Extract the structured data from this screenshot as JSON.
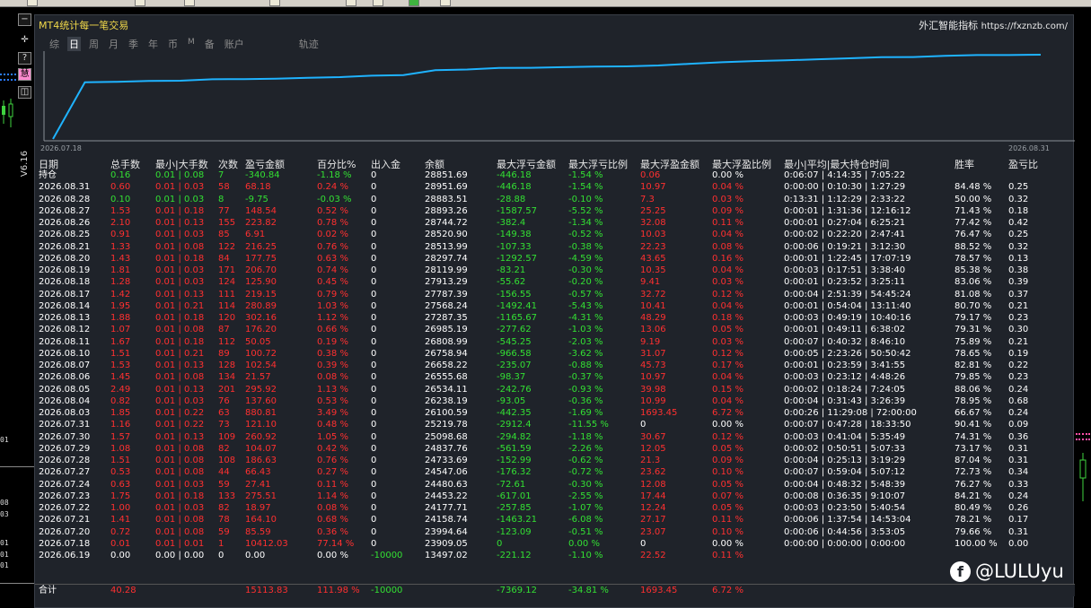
{
  "window": {
    "title": "MT4统计每一笔交易",
    "brand_name": "外汇智能指标",
    "brand_url": "https://fxznzb.com/"
  },
  "left_strip": {
    "buttons": [
      "−",
      "✛",
      "?",
      "慧",
      "◫"
    ],
    "version": "V6.16",
    "price_labels": [
      "01",
      "08",
      "03",
      "01",
      "01",
      "01"
    ]
  },
  "tabs": [
    {
      "label": "综",
      "active": false
    },
    {
      "label": "日",
      "active": true
    },
    {
      "label": "周",
      "active": false
    },
    {
      "label": "月",
      "active": false
    },
    {
      "label": "季",
      "active": false
    },
    {
      "label": "年",
      "active": false
    },
    {
      "label": "币",
      "active": false
    },
    {
      "label": "M",
      "active": false
    },
    {
      "label": "备",
      "active": false
    },
    {
      "label": "账户",
      "active": false
    },
    {
      "label": "轨迹",
      "active": false
    }
  ],
  "chart_data": {
    "type": "line",
    "x_start_label": "2026.07.18",
    "x_end_label": "2026.08.31",
    "color": "#1fb3ff"
  },
  "table": {
    "columns": [
      "日期",
      "总手数",
      "最小|大手数",
      "次数",
      "盈亏金额",
      "百分比%",
      "出入金",
      "余额",
      "最大浮亏金额",
      "最大浮亏比例",
      "最大浮盈金额",
      "最大浮盈比例",
      "最小|平均|最大持仓时间",
      "胜率",
      "盈亏比"
    ],
    "rows": [
      [
        "持仓",
        "0.16",
        "0.01 | 0.08",
        "7",
        "-340.84",
        "-1.18 %",
        "0",
        "28851.69",
        "-446.18",
        "-1.54 %",
        "0.06",
        "0.00 %",
        "0:06:07 | 4:14:35 | 7:05:22",
        "",
        ""
      ],
      [
        "2026.08.31",
        "0.60",
        "0.01 | 0.03",
        "58",
        "68.18",
        "0.24 %",
        "0",
        "28951.69",
        "-446.18",
        "-1.54 %",
        "10.97",
        "0.04 %",
        "0:00:00 | 0:10:30 | 1:27:29",
        "84.48 %",
        "0.25"
      ],
      [
        "2026.08.28",
        "0.10",
        "0.01 | 0.03",
        "8",
        "-9.75",
        "-0.03 %",
        "0",
        "28883.51",
        "-28.88",
        "-0.10 %",
        "7.3",
        "0.03 %",
        "0:13:31 | 1:12:29 | 2:33:22",
        "50.00 %",
        "0.32"
      ],
      [
        "2026.08.27",
        "1.53",
        "0.01 | 0.18",
        "77",
        "148.54",
        "0.52 %",
        "0",
        "28893.26",
        "-1587.57",
        "-5.52 %",
        "25.25",
        "0.09 %",
        "0:00:01 | 1:31:36 | 12:16:12",
        "71.43 %",
        "0.18"
      ],
      [
        "2026.08.26",
        "2.10",
        "0.01 | 0.13",
        "155",
        "223.82",
        "0.78 %",
        "0",
        "28744.72",
        "-382.4",
        "-1.34 %",
        "32.08",
        "0.11 %",
        "0:00:01 | 0:27:04 | 6:25:21",
        "77.42 %",
        "0.42"
      ],
      [
        "2026.08.25",
        "0.91",
        "0.01 | 0.03",
        "85",
        "6.91",
        "0.02 %",
        "0",
        "28520.90",
        "-149.38",
        "-0.52 %",
        "10.03",
        "0.04 %",
        "0:00:02 | 0:22:20 | 2:47:41",
        "76.47 %",
        "0.25"
      ],
      [
        "2026.08.21",
        "1.33",
        "0.01 | 0.08",
        "122",
        "216.25",
        "0.76 %",
        "0",
        "28513.99",
        "-107.33",
        "-0.38 %",
        "22.23",
        "0.08 %",
        "0:00:06 | 0:19:21 | 3:12:30",
        "88.52 %",
        "0.32"
      ],
      [
        "2026.08.20",
        "1.43",
        "0.01 | 0.18",
        "84",
        "177.75",
        "0.63 %",
        "0",
        "28297.74",
        "-1292.57",
        "-4.59 %",
        "43.65",
        "0.16 %",
        "0:00:01 | 1:22:45 | 17:07:19",
        "78.57 %",
        "0.13"
      ],
      [
        "2026.08.19",
        "1.81",
        "0.01 | 0.03",
        "171",
        "206.70",
        "0.74 %",
        "0",
        "28119.99",
        "-83.21",
        "-0.30 %",
        "10.35",
        "0.04 %",
        "0:00:03 | 0:17:51 | 3:38:40",
        "85.38 %",
        "0.38"
      ],
      [
        "2026.08.18",
        "1.28",
        "0.01 | 0.03",
        "124",
        "125.90",
        "0.45 %",
        "0",
        "27913.29",
        "-55.62",
        "-0.20 %",
        "9.41",
        "0.03 %",
        "0:00:01 | 0:23:52 | 3:25:11",
        "83.06 %",
        "0.39"
      ],
      [
        "2026.08.17",
        "1.42",
        "0.01 | 0.13",
        "111",
        "219.15",
        "0.79 %",
        "0",
        "27787.39",
        "-156.55",
        "-0.57 %",
        "32.72",
        "0.12 %",
        "0:00:04 | 2:51:39 | 54:45:24",
        "81.08 %",
        "0.37"
      ],
      [
        "2026.08.14",
        "1.95",
        "0.01 | 0.21",
        "114",
        "280.89",
        "1.03 %",
        "0",
        "27568.24",
        "-1492.41",
        "-5.43 %",
        "10.41",
        "0.04 %",
        "0:00:01 | 0:54:04 | 13:11:40",
        "80.70 %",
        "0.21"
      ],
      [
        "2026.08.13",
        "1.88",
        "0.01 | 0.18",
        "120",
        "302.16",
        "1.12 %",
        "0",
        "27287.35",
        "-1165.67",
        "-4.31 %",
        "48.29",
        "0.18 %",
        "0:00:03 | 0:49:19 | 10:40:16",
        "79.17 %",
        "0.23"
      ],
      [
        "2026.08.12",
        "1.07",
        "0.01 | 0.08",
        "87",
        "176.20",
        "0.66 %",
        "0",
        "26985.19",
        "-277.62",
        "-1.03 %",
        "13.06",
        "0.05 %",
        "0:00:01 | 0:49:11 | 6:38:02",
        "79.31 %",
        "0.30"
      ],
      [
        "2026.08.11",
        "1.67",
        "0.01 | 0.18",
        "112",
        "50.05",
        "0.19 %",
        "0",
        "26808.99",
        "-545.25",
        "-2.03 %",
        "9.19",
        "0.03 %",
        "0:00:07 | 0:40:32 | 8:46:10",
        "75.89 %",
        "0.21"
      ],
      [
        "2026.08.10",
        "1.51",
        "0.01 | 0.21",
        "89",
        "100.72",
        "0.38 %",
        "0",
        "26758.94",
        "-966.58",
        "-3.62 %",
        "31.07",
        "0.12 %",
        "0:00:05 | 2:23:26 | 50:50:42",
        "78.65 %",
        "0.19"
      ],
      [
        "2026.08.07",
        "1.53",
        "0.01 | 0.13",
        "128",
        "102.54",
        "0.39 %",
        "0",
        "26658.22",
        "-235.07",
        "-0.88 %",
        "45.73",
        "0.17 %",
        "0:00:01 | 0:23:59 | 3:41:55",
        "82.81 %",
        "0.22"
      ],
      [
        "2026.08.06",
        "1.45",
        "0.01 | 0.08",
        "134",
        "21.57",
        "0.08 %",
        "0",
        "26555.68",
        "-98.37",
        "-0.37 %",
        "10.97",
        "0.04 %",
        "0:00:03 | 0:23:12 | 4:48:26",
        "79.85 %",
        "0.23"
      ],
      [
        "2026.08.05",
        "2.49",
        "0.01 | 0.13",
        "201",
        "295.92",
        "1.13 %",
        "0",
        "26534.11",
        "-242.76",
        "-0.93 %",
        "39.98",
        "0.15 %",
        "0:00:02 | 0:18:24 | 7:24:05",
        "88.06 %",
        "0.24"
      ],
      [
        "2026.08.04",
        "0.82",
        "0.01 | 0.03",
        "76",
        "137.60",
        "0.53 %",
        "0",
        "26238.19",
        "-93.05",
        "-0.36 %",
        "10.99",
        "0.04 %",
        "0:00:04 | 0:31:43 | 3:26:39",
        "78.95 %",
        "0.68"
      ],
      [
        "2026.08.03",
        "1.85",
        "0.01 | 0.22",
        "63",
        "880.81",
        "3.49 %",
        "0",
        "26100.59",
        "-442.35",
        "-1.69 %",
        "1693.45",
        "6.72 %",
        "0:00:26 | 11:29:08 | 72:00:00",
        "66.67 %",
        "0.24"
      ],
      [
        "2026.07.31",
        "1.16",
        "0.01 | 0.22",
        "73",
        "121.10",
        "0.48 %",
        "0",
        "25219.78",
        "-2912.4",
        "-11.55 %",
        "0",
        "0.00 %",
        "0:00:07 | 0:47:28 | 18:33:50",
        "90.41 %",
        "0.09"
      ],
      [
        "2026.07.30",
        "1.57",
        "0.01 | 0.13",
        "109",
        "260.92",
        "1.05 %",
        "0",
        "25098.68",
        "-294.82",
        "-1.18 %",
        "30.67",
        "0.12 %",
        "0:00:03 | 0:41:04 | 5:35:49",
        "74.31 %",
        "0.36"
      ],
      [
        "2026.07.29",
        "1.08",
        "0.01 | 0.08",
        "82",
        "104.07",
        "0.42 %",
        "0",
        "24837.76",
        "-561.59",
        "-2.26 %",
        "12.05",
        "0.05 %",
        "0:00:02 | 0:50:51 | 5:07:33",
        "73.17 %",
        "0.31"
      ],
      [
        "2026.07.28",
        "1.51",
        "0.01 | 0.08",
        "108",
        "186.63",
        "0.76 %",
        "0",
        "24733.69",
        "-152.99",
        "-0.62 %",
        "21.3",
        "0.09 %",
        "0:00:04 | 0:25:13 | 3:19:29",
        "87.04 %",
        "0.31"
      ],
      [
        "2026.07.27",
        "0.53",
        "0.01 | 0.08",
        "44",
        "66.43",
        "0.27 %",
        "0",
        "24547.06",
        "-176.32",
        "-0.72 %",
        "23.62",
        "0.10 %",
        "0:00:07 | 0:59:04 | 5:07:12",
        "72.73 %",
        "0.34"
      ],
      [
        "2026.07.24",
        "0.63",
        "0.01 | 0.03",
        "59",
        "27.41",
        "0.11 %",
        "0",
        "24480.63",
        "-72.61",
        "-0.30 %",
        "12.08",
        "0.05 %",
        "0:00:04 | 0:48:32 | 5:48:39",
        "76.27 %",
        "0.33"
      ],
      [
        "2026.07.23",
        "1.75",
        "0.01 | 0.18",
        "133",
        "275.51",
        "1.14 %",
        "0",
        "24453.22",
        "-617.01",
        "-2.55 %",
        "17.44",
        "0.07 %",
        "0:00:08 | 0:36:35 | 9:10:07",
        "84.21 %",
        "0.24"
      ],
      [
        "2026.07.22",
        "1.00",
        "0.01 | 0.03",
        "82",
        "18.97",
        "0.08 %",
        "0",
        "24177.71",
        "-257.85",
        "-1.07 %",
        "12.24",
        "0.05 %",
        "0:00:03 | 0:23:50 | 5:40:54",
        "80.49 %",
        "0.26"
      ],
      [
        "2026.07.21",
        "1.41",
        "0.01 | 0.08",
        "78",
        "164.10",
        "0.68 %",
        "0",
        "24158.74",
        "-1463.21",
        "-6.08 %",
        "27.17",
        "0.11 %",
        "0:00:06 | 1:37:54 | 14:53:04",
        "78.21 %",
        "0.17"
      ],
      [
        "2026.07.20",
        "0.72",
        "0.01 | 0.08",
        "59",
        "85.59",
        "0.36 %",
        "0",
        "23994.64",
        "-123.09",
        "-0.51 %",
        "23.07",
        "0.10 %",
        "0:00:06 | 0:44:56 | 3:53:05",
        "79.66 %",
        "0.31"
      ],
      [
        "2026.07.18",
        "0.01",
        "0.01 | 0.01",
        "1",
        "10412.03",
        "77.14 %",
        "0",
        "23909.05",
        "0",
        "0.00 %",
        "0",
        "0.00 %",
        "0:00:00 | 0:00:00 | 0:00:00",
        "100.00 %",
        "0.00"
      ],
      [
        "2026.06.19",
        "0.00",
        "0.00 | 0.00",
        "0",
        "0.00",
        "0.00 %",
        "-10000",
        "13497.02",
        "-221.12",
        "-1.10 %",
        "22.52",
        "0.11 %",
        "",
        "",
        ""
      ]
    ],
    "totals": [
      "合计",
      "40.28",
      "",
      "",
      "15113.83",
      "111.98 %",
      "-10000",
      "",
      "-7369.12",
      "-34.81 %",
      "1693.45",
      "6.72 %",
      "",
      "",
      ""
    ]
  },
  "watermark": {
    "text": "@LULUyu",
    "icon": "facebook-icon"
  }
}
